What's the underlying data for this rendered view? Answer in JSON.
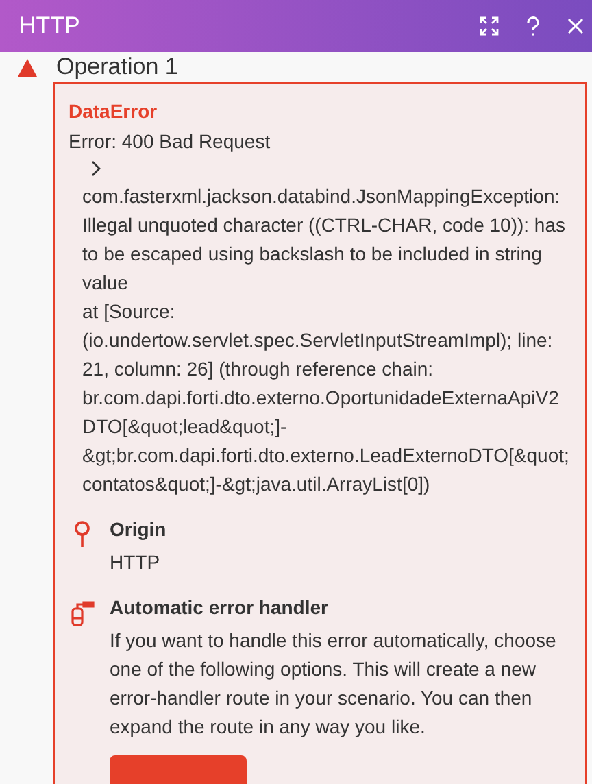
{
  "window": {
    "title": "HTTP"
  },
  "operation": {
    "label": "Operation 1"
  },
  "error": {
    "type": "DataError",
    "summary": "Error: 400 Bad Request",
    "expanded": false,
    "detail": "com.fasterxml.jackson.databind.JsonMappingException: Illegal unquoted character ((CTRL-CHAR, code 10)): has to be escaped using backslash to be included in string value\nat [Source: (io.undertow.servlet.spec.ServletInputStreamImpl); line: 21, column: 26] (through reference chain: br.com.dapi.forti.dto.externo.OportunidadeExternaApiV2DTO[&quot;lead&quot;]-&gt;br.com.dapi.forti.dto.externo.LeadExternoDTO[&quot;contatos&quot;]-&gt;java.util.ArrayList[0])"
  },
  "sections": [
    {
      "kind": "origin",
      "title": "Origin",
      "text": "HTTP"
    },
    {
      "kind": "handler",
      "title": "Automatic error handler",
      "text": "If you want to handle this error automatically, choose one of the following options. This will create a new error-handler route in your scenario. You can then expand the route in any way you like."
    }
  ]
}
